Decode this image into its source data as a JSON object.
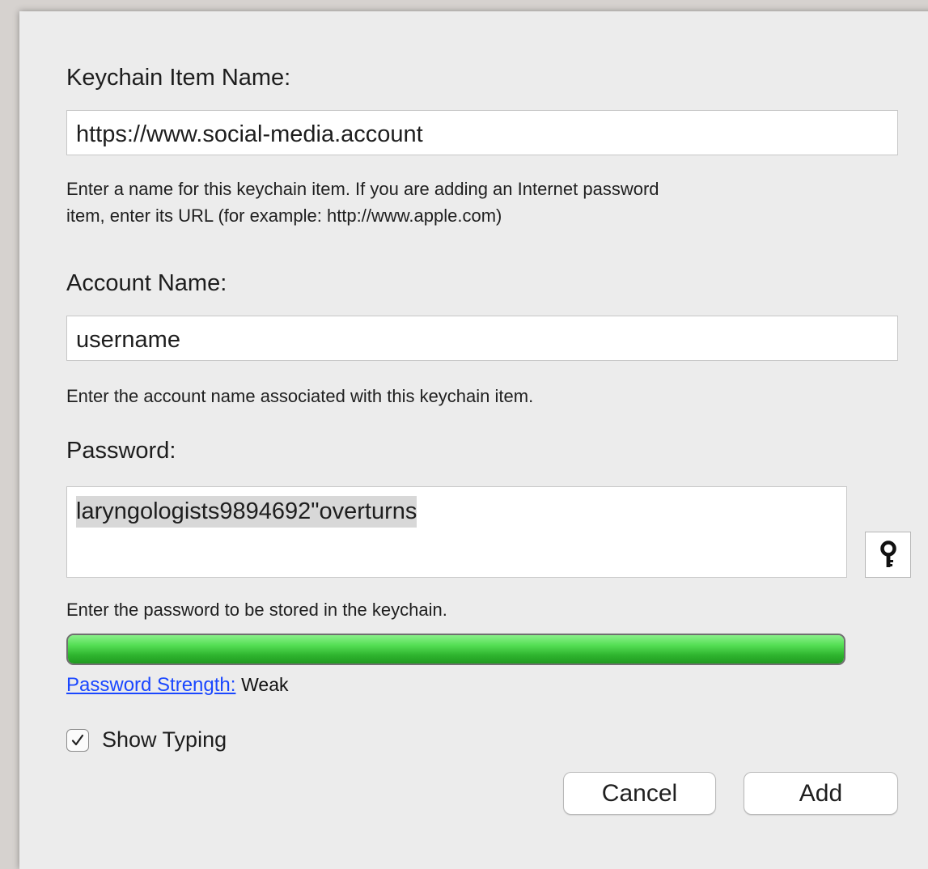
{
  "form": {
    "item_name_label": "Keychain Item Name:",
    "item_name_value": "https://www.social-media.account",
    "item_name_help_line1": "Enter a name for this keychain item. If you are adding an Internet password",
    "item_name_help_line2": "item, enter its URL (for example: http://www.apple.com)",
    "account_label": "Account Name:",
    "account_value": "username",
    "account_help": "Enter the account name associated with this keychain item.",
    "password_label": "Password:",
    "password_value": "laryngologists9894692\"overturns",
    "password_help": "Enter the password to be stored in the keychain.",
    "key_button_icon": "key-icon",
    "strength_link": "Password Strength:",
    "strength_value": "Weak",
    "strength_fill": 1.0,
    "strength_color": "#3fcc3f",
    "show_typing_label": "Show Typing",
    "show_typing_checked": true
  },
  "buttons": {
    "cancel": "Cancel",
    "add": "Add"
  }
}
